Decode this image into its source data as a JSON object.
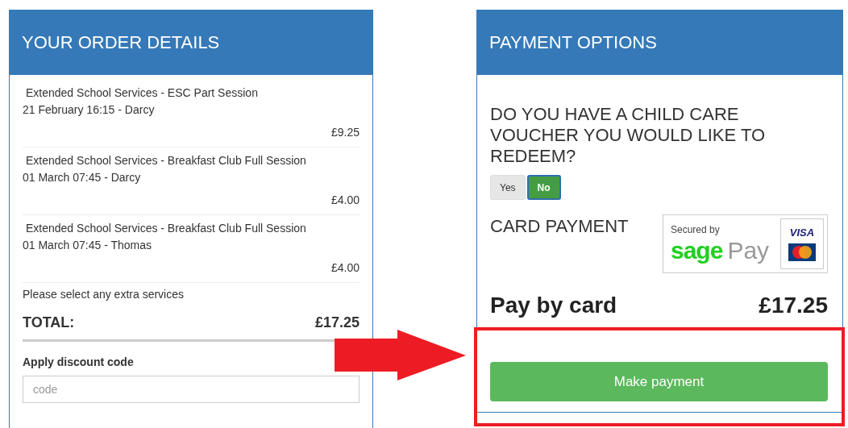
{
  "order": {
    "title": "YOUR ORDER DETAILS",
    "items": [
      {
        "name": "Extended School Services - ESC Part Session",
        "when": "21 February 16:15 - Darcy",
        "price": "£9.25"
      },
      {
        "name": "Extended School Services - Breakfast Club Full Session",
        "when": "01 March 07:45 - Darcy",
        "price": "£4.00"
      },
      {
        "name": "Extended School Services - Breakfast Club Full Session",
        "when": "01 March 07:45 - Thomas",
        "price": "£4.00"
      }
    ],
    "extras_prompt": "Please select any extra services",
    "total_label": "TOTAL:",
    "total": "£17.25",
    "discount": {
      "label": "Apply discount code",
      "placeholder": "code"
    }
  },
  "payment": {
    "title": "PAYMENT OPTIONS",
    "voucher_question": "DO YOU HAVE A CHILD CARE VOUCHER YOU WOULD LIKE TO REDEEM?",
    "voucher_options": [
      {
        "label": "Yes",
        "selected": false
      },
      {
        "label": "No",
        "selected": true
      }
    ],
    "card_heading": "CARD PAYMENT",
    "logo": {
      "secured_by": "Secured by",
      "brand_1": "sage",
      "brand_2": "Pay",
      "card_1": "VISA"
    },
    "pay_label": "Pay by card",
    "pay_amount": "£17.25",
    "button": "Make payment"
  }
}
